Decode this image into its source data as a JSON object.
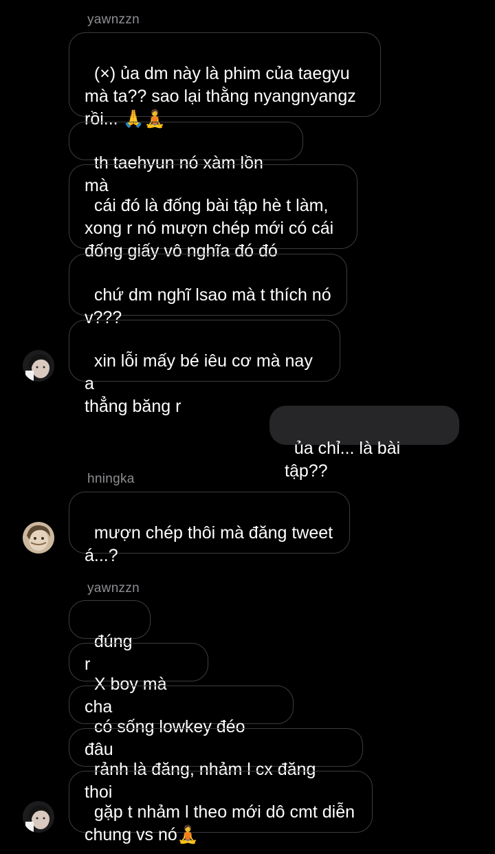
{
  "colors": {
    "background": "#000000",
    "bubble_border": "#3d3d3f",
    "outgoing_bubble": "#262629",
    "sender_name": "#8e8e93",
    "text": "#ffffff"
  },
  "groups": [
    {
      "sender": "yawnzzn",
      "messages": [
        "(×) ủa dm này là phim của taegyu\nmà ta?? sao lại thằng nyangnyangz\nrồi... 🙏🧘",
        "th taehyun nó xàm lồn mà",
        "cái đó là đống bài tập hè t làm,\nxong r nó mượn chép mới có cái\nđống giấy vô nghĩa đó đó",
        "chứ dm nghĩ lsao mà t thích nó\nv???",
        "xin lỗi mấy bé iêu cơ mà nay a\nthẳng băng r"
      ]
    },
    {
      "sender": "me",
      "messages": [
        "ủa chỉ... là bài tập??"
      ]
    },
    {
      "sender": "hningka",
      "messages": [
        "mượn chép thôi mà đăng tweet\ná...?"
      ]
    },
    {
      "sender": "yawnzzn",
      "messages": [
        "đúng r",
        "X boy mà cha",
        "có sống lowkey đéo đâu",
        "rảnh là đăng, nhảm l cx đăng thoi",
        "gặp t nhảm l theo mới dô cmt diễn\nchung vs nó🧘"
      ]
    }
  ],
  "avatars": [
    {
      "name": "yawnzzn-avatar-icon"
    },
    {
      "name": "hningka-avatar-icon"
    },
    {
      "name": "yawnzzn-avatar-icon"
    }
  ]
}
